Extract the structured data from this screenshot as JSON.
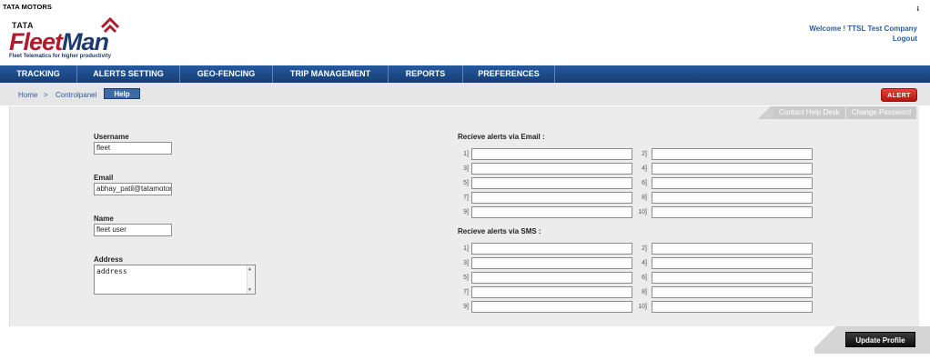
{
  "brand": {
    "company": "TATA MOTORS",
    "logo_small": "TATA",
    "logo_fleet": "Fleet",
    "logo_man": "Man",
    "tagline": "Fleet Telematics for higher productivity"
  },
  "header": {
    "top_right_glyph": "ℹ",
    "welcome": "Welcome ! TTSL Test Company",
    "logout": "Logout"
  },
  "nav": {
    "items": [
      {
        "label": "TRACKING"
      },
      {
        "label": "ALERTS SETTING"
      },
      {
        "label": "GEO-FENCING"
      },
      {
        "label": "TRIP MANAGEMENT"
      },
      {
        "label": "REPORTS"
      },
      {
        "label": "PREFERENCES"
      }
    ]
  },
  "breadcrumb": {
    "home": "Home",
    "separator": ">",
    "controlpanel": "Controlpanel",
    "current": "Help"
  },
  "alert_button": "ALERT",
  "panel_tabs": {
    "contact": "Contact Help Desk",
    "change_password": "Change Password"
  },
  "profile": {
    "username_label": "Username",
    "username_value": "fleet",
    "email_label": "Email",
    "email_value": "abhay_patil@tatamotors",
    "name_label": "Name",
    "name_value": "fleet user",
    "address_label": "Address",
    "address_value": "address"
  },
  "email_alerts": {
    "title": "Recieve alerts via Email :",
    "slots": [
      "1]",
      "2]",
      "3]",
      "4]",
      "5]",
      "6]",
      "7]",
      "8]",
      "9]",
      "10]"
    ]
  },
  "sms_alerts": {
    "title": "Recieve alerts via SMS :",
    "slots": [
      "1]",
      "2]",
      "3]",
      "4]",
      "5]",
      "6]",
      "7]",
      "8]",
      "9]",
      "10]"
    ]
  },
  "update_button": "Update Profile",
  "colors": {
    "nav_blue": "#1d4a87",
    "brand_red": "#b01c2e",
    "brand_navy": "#1d3a6d",
    "link_blue": "#2a5d9a",
    "alert_red": "#c9211b"
  }
}
